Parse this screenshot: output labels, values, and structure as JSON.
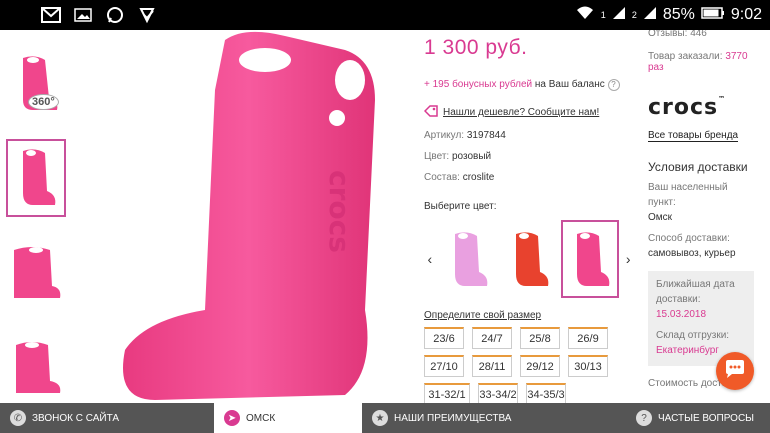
{
  "status_bar": {
    "battery": "85%",
    "time": "9:02",
    "sim": "1",
    "sim2": "2"
  },
  "product": {
    "price": "1 300 руб.",
    "bonus_amount": "+ 195 бонусных рублей",
    "bonus_text": " на Ваш баланс",
    "bonus_help": "?",
    "cheaper": "Нашли дешевле? Сообщите нам!",
    "article_label": "Артикул: ",
    "article_value": "3197844",
    "color_label": "Цвет: ",
    "color_value": "розовый",
    "material_label": "Состав: ",
    "material_value": "croslite",
    "choose_color": "Выберите цвет:",
    "size_link": "Определите свой размер",
    "sizes": [
      "23/6",
      "24/7",
      "25/8",
      "26/9",
      "27/10",
      "28/11",
      "29/12",
      "30/13",
      "31-32/1",
      "33-34/2",
      "34-35/3"
    ],
    "swatch_colors": [
      "#e9a0e0",
      "#e8422e",
      "#f0468c"
    ],
    "boot_color": "#f0468c"
  },
  "sidebar": {
    "orders_row": "Отзывы: 446",
    "ordered_label": "Товар заказали: ",
    "ordered_value": "3770 раз",
    "brand_logo": "crocs",
    "all_brand": "Все товары бренда",
    "delivery_heading": "Условия доставки",
    "locality_label": "Ваш населенный пункт:",
    "locality_value": "Омск",
    "method_label": "Способ доставки:",
    "method_value": "самовывоз, курьер",
    "nearest_label": "Ближайшая дата доставки:",
    "nearest_value": "15.03.2018",
    "warehouse_label": "Склад отгрузки:",
    "warehouse_value": "Екатеринбург",
    "cost_label": "Стоимость доставки:"
  },
  "bottom_bar": {
    "call": "ЗВОНОК С САЙТА",
    "city": "ОМСК",
    "advantages": "НАШИ ПРЕИМУЩЕСТВА",
    "faq": "ЧАСТЫЕ ВОПРОСЫ"
  },
  "colors": {
    "accent": "#d93a91",
    "chat": "#f05a28"
  }
}
